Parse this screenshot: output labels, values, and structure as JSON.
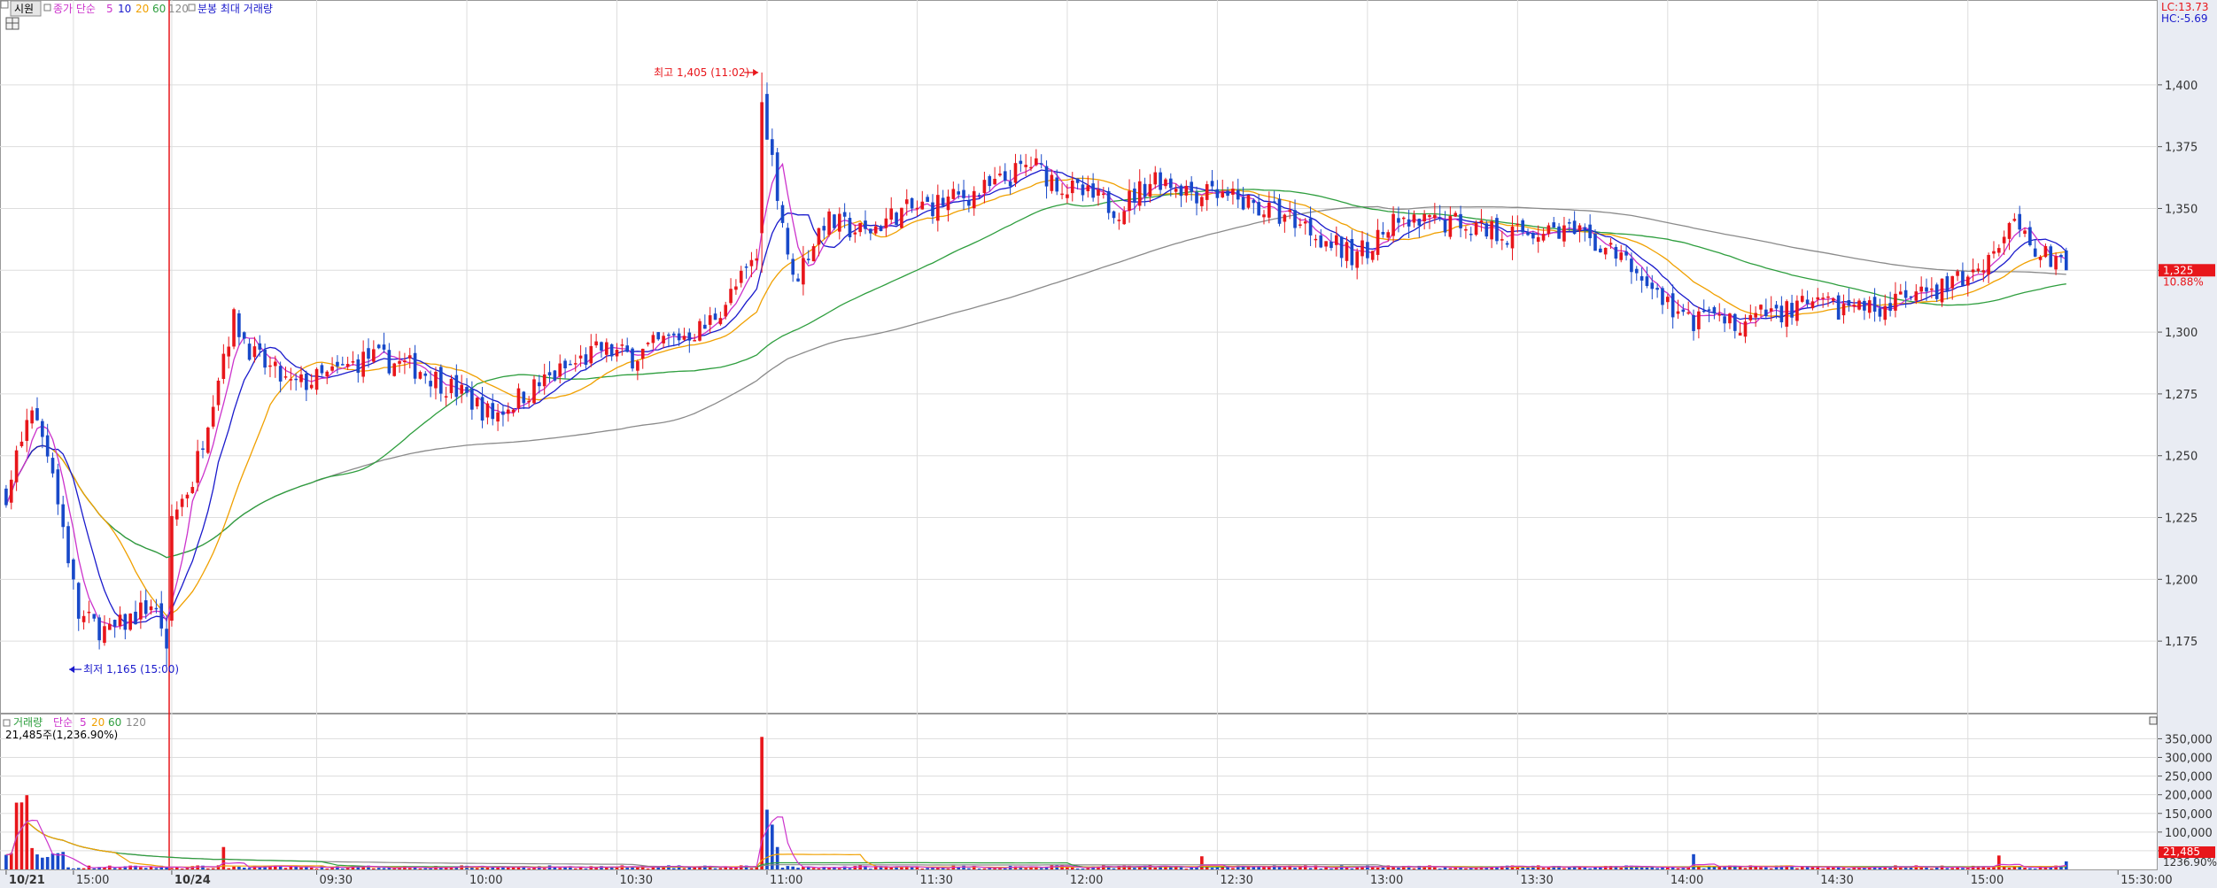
{
  "toolbar": {
    "mode_label": "시원",
    "price_ma_label": "종가 단순",
    "ma_periods": [
      "5",
      "10",
      "20",
      "60",
      "120"
    ],
    "peak_label": "분봉 최대 거래량"
  },
  "right_readout": {
    "lc": "LC:13.73",
    "hc": "HC:-5.69"
  },
  "price_tag": {
    "value": "1,325",
    "pct": "10.88%"
  },
  "volume_panel": {
    "title": "거래량",
    "ma_label": "단순",
    "ma_periods": [
      "5",
      "20",
      "60",
      "120"
    ],
    "current_label": "21,485주(1,236.90%)",
    "tag_value": "21,485",
    "tag_pct": "1236.90%"
  },
  "annotations": {
    "high": "최고 1,405 (11:02)",
    "low": "최저 1,165 (15:00)"
  },
  "colors": {
    "up": "#e8161b",
    "down": "#1849c9",
    "ma5": "#cc33cc",
    "ma10": "#1a1acc",
    "ma20": "#f0a000",
    "ma60": "#2e9e3e",
    "ma120": "#8a8a8a",
    "grid": "#dddddd",
    "axis_bg": "#e9ecf3",
    "divider": "#e8161b"
  },
  "chart_data": [
    {
      "type": "candlestick",
      "title": "",
      "ylim": [
        1155,
        1420
      ],
      "y_ticks": [
        1175,
        1200,
        1225,
        1250,
        1275,
        1300,
        1325,
        1350,
        1375,
        1400
      ],
      "y_tick_labels": [
        "1,175",
        "1,200",
        "1,225",
        "1,250",
        "1,275",
        "1,300",
        "1,325",
        "1,350",
        "1,375",
        "1,400"
      ],
      "x_labels": [
        "10/21",
        "15:00",
        "10/24",
        "09:30",
        "10:00",
        "10:30",
        "11:00",
        "11:30",
        "12:00",
        "12:30",
        "13:00",
        "13:30",
        "14:00",
        "14:30",
        "15:00",
        "15:30:00"
      ],
      "x_label_bars": [
        0,
        13,
        32,
        60,
        89,
        118,
        147,
        176,
        205,
        234,
        263,
        292,
        321,
        350,
        379,
        408
      ],
      "high": {
        "value": 1405,
        "time": "11:02"
      },
      "low": {
        "value": 1165,
        "time": "15:00"
      },
      "last_price": 1325,
      "series": [
        "MA5",
        "MA10",
        "MA20",
        "MA60",
        "MA120"
      ]
    },
    {
      "type": "bar",
      "title": "거래량",
      "ylim": [
        0,
        370000
      ],
      "y_ticks": [
        50000,
        100000,
        150000,
        200000,
        250000,
        300000,
        350000
      ],
      "y_tick_labels": [
        "50,000",
        "100,000",
        "150,000",
        "200,000",
        "250,000",
        "300,000",
        "350,000"
      ],
      "peak_volume": 355000,
      "last_volume": 21485
    }
  ]
}
